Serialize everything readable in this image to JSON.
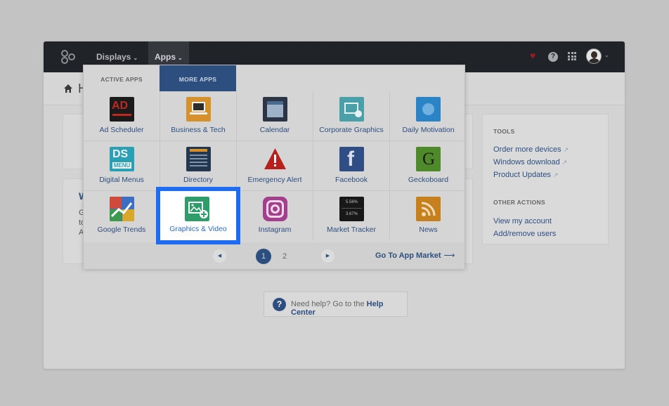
{
  "topnav": {
    "menus": [
      {
        "label": "Displays",
        "caret": "⌄"
      },
      {
        "label": "Apps",
        "caret": "⌄"
      }
    ],
    "icons": [
      "logo-icon",
      "heart-icon",
      "help-icon",
      "apps-grid-icon",
      "avatar",
      "chevron-down-icon"
    ],
    "help_glyph": "?"
  },
  "subbar": {
    "title": "H"
  },
  "cards": {
    "card2_title": "W",
    "card2_lines": [
      "G",
      "to",
      "A"
    ]
  },
  "tools": {
    "heading": "TOOLS",
    "links": [
      {
        "label": "Order more devices"
      },
      {
        "label": "Windows download"
      },
      {
        "label": "Product Updates"
      }
    ],
    "other_heading": "OTHER ACTIONS",
    "other_links": [
      {
        "label": "View my account"
      },
      {
        "label": "Add/remove users"
      }
    ],
    "external_glyph": "↗"
  },
  "help": {
    "glyph": "?",
    "text": "Need help? Go to the ",
    "link": "Help Center"
  },
  "apps_menu": {
    "tabs": [
      {
        "label": "ACTIVE APPS"
      },
      {
        "label": "MORE APPS"
      }
    ],
    "active_tab": "MORE APPS",
    "apps": [
      {
        "label": "Ad Scheduler",
        "icon": "ad-scheduler-icon",
        "icon_text": "AD"
      },
      {
        "label": "Business & Tech",
        "icon": "business-tech-icon"
      },
      {
        "label": "Calendar",
        "icon": "calendar-icon"
      },
      {
        "label": "Corporate Graphics",
        "icon": "corporate-graphics-icon"
      },
      {
        "label": "Daily Motivation",
        "icon": "daily-motivation-icon"
      },
      {
        "label": "Digital Menus",
        "icon": "digital-menus-icon",
        "icon_text": "DS",
        "icon_subtext": "MENU"
      },
      {
        "label": "Directory",
        "icon": "directory-icon"
      },
      {
        "label": "Emergency Alert",
        "icon": "emergency-alert-icon"
      },
      {
        "label": "Facebook",
        "icon": "facebook-icon",
        "icon_text": "f"
      },
      {
        "label": "Geckoboard",
        "icon": "geckoboard-icon",
        "icon_text": "G"
      },
      {
        "label": "Google Trends",
        "icon": "google-trends-icon"
      },
      {
        "label": "Graphics & Video",
        "icon": "graphics-video-icon"
      },
      {
        "label": "Instagram",
        "icon": "instagram-icon"
      },
      {
        "label": "Market Tracker",
        "icon": "market-tracker-icon",
        "icon_text": "5.56%",
        "icon_subtext": "3.67%"
      },
      {
        "label": "News",
        "icon": "news-rss-icon"
      }
    ],
    "highlighted_app": "Graphics & Video",
    "pagination": {
      "prev": "◀",
      "next": "▶",
      "pages": [
        "1",
        "2"
      ],
      "current": "1"
    },
    "market_link": "Go To App Market",
    "market_arrow": "⟶"
  },
  "colors": {
    "nav_bg": "#202328",
    "accent": "#2d4f80",
    "highlight_border": "#1d6cf2",
    "heart": "#9b1b22"
  }
}
